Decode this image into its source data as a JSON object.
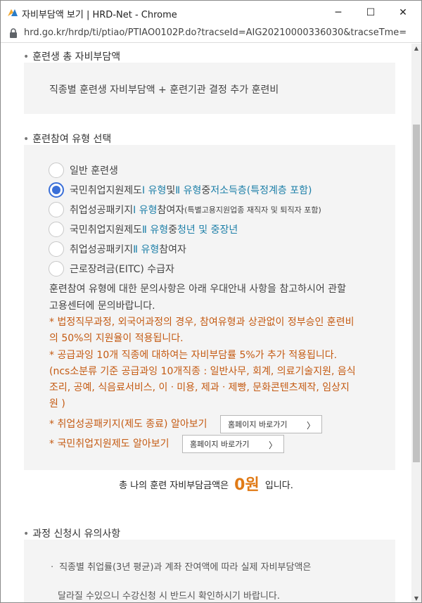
{
  "window": {
    "title": "자비부담액 보기 | HRD-Net - Chrome",
    "controls": {
      "minimize": "─",
      "maximize": "☐",
      "close": "✕"
    }
  },
  "address": {
    "url": "hrd.go.kr/hrdp/ti/ptiao/PTIAO0102P.do?tracseId=AIG20210000336030&tracseTme=..."
  },
  "section1": {
    "title": "훈련생 총 자비부담액",
    "formula": "직종별 훈련생 자비부담액 + 훈련기관 결정 추가 훈련비"
  },
  "section2": {
    "title": "훈련참여 유형 선택",
    "options": [
      {
        "parts": [
          "일반 훈련생"
        ],
        "checked": false
      },
      {
        "p1": "국민취업지원제도 ",
        "p2": "Ⅰ 유형",
        "p3": " 및 ",
        "p4": "Ⅱ 유형",
        "p5": " 중 ",
        "p6": "저소득층(특정계층 포함)",
        "checked": true
      },
      {
        "p1": "취업성공패키지 ",
        "p2": "Ⅰ 유형",
        "p3": " 참여자",
        "p4": "(특별고용지원업종 재직자 및 퇴직자 포함)",
        "checked": false
      },
      {
        "p1": "국민취업지원제도 ",
        "p2": "Ⅱ 유형",
        "p3": " 중 ",
        "p4": "청년 및 중장년",
        "checked": false
      },
      {
        "p1": "취업성공패키지 ",
        "p2": "Ⅱ 유형",
        "p3": " 참여자",
        "checked": false
      },
      {
        "p1": "근로장려금(EITC) 수급자",
        "checked": false
      }
    ],
    "info_line1": "훈련참여 유형에 대한 문의사항은 아래 우대안내 사항을 참고하시어 관할",
    "info_line2": "고용센터에 문의바랍니다.",
    "note1_line1": "* 법정직무과정, 외국어과정의 경우, 참여유형과 상관없이 정부승인 훈련비",
    "note1_line2": "의 50%의 지원율이 적용됩니다.",
    "note2_line1": "* 공급과잉 10개 직종에 대하여는 자비부담률 5%가 추가 적용됩니다.",
    "note2_line2": "(ncs소분류 기준 공급과잉 10개직종 : 일반사무, 회계, 의료기술지원, 음식",
    "note2_line3": "조리, 공예, 식음료서비스, 이ㆍ미용, 제과ㆍ제빵, 문화콘텐츠제작, 임상지",
    "note2_line4": "원 )",
    "link1_label": "* 취업성공패키지(제도 종료) 알아보기",
    "link1_button": "홈페이지 바로가기",
    "link2_label": "* 국민취업지원제도 알아보기",
    "link2_button": "홈페이지 바로가기"
  },
  "total": {
    "prefix": "총 나의 훈련 자비부담금액은",
    "amount": "0원",
    "suffix": "입니다."
  },
  "section3": {
    "title": "과정 신청시 유의사항",
    "line1": "직종별 취업률(3년 평균)과 계좌 잔여액에 따라 실제 자비부담액은",
    "line2": "달라질 수있으니 수강신청 시 반드시 확인하시기 바랍니다."
  },
  "colors": {
    "accent_blue": "#1d7fa8",
    "radio_blue": "#3a6fd8",
    "orange_note": "#c45a12",
    "amount_orange": "#e07a16"
  },
  "icons": {
    "app": "hrd-net-app-icon",
    "lock": "lock-icon",
    "chevron": "chevron-right-icon"
  }
}
